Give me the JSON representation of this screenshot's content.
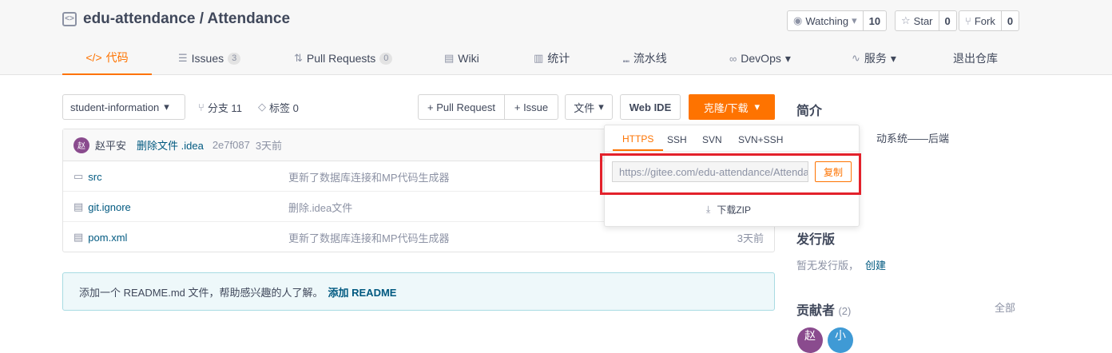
{
  "repo": {
    "title": "edu-attendance / Attendance"
  },
  "social": {
    "watching_label": "Watching",
    "watching_count": "10",
    "star_label": "Star",
    "star_count": "0",
    "fork_label": "Fork",
    "fork_count": "0"
  },
  "tabs": [
    {
      "label": "代码",
      "icon": "code-icon"
    },
    {
      "label": "Issues",
      "badge": "3",
      "icon": "issues-icon"
    },
    {
      "label": "Pull Requests",
      "badge": "0",
      "icon": "pull-request-icon"
    },
    {
      "label": "Wiki",
      "icon": "wiki-icon"
    },
    {
      "label": "统计",
      "icon": "chart-icon"
    },
    {
      "label": "流水线",
      "icon": "pipeline-icon"
    },
    {
      "label": "DevOps",
      "icon": "infinity-icon"
    },
    {
      "label": "服务",
      "icon": "pulse-icon"
    },
    {
      "label": "退出仓库"
    }
  ],
  "toolbar": {
    "branch": "student-information",
    "branches": "分支 11",
    "tags": "标签 0",
    "pull_request": "+ Pull Request",
    "issue": "+ Issue",
    "file": "文件",
    "web_ide": "Web IDE",
    "clone": "克隆/下载"
  },
  "commit": {
    "avatar": "赵",
    "author": "赵平安",
    "message": "删除文件 .idea",
    "hash": "2e7f087",
    "time": "3天前"
  },
  "files": [
    {
      "name": "src",
      "message": "更新了数据库连接和MP代码生成器",
      "time": "",
      "icon": "folder-icon"
    },
    {
      "name": "git.ignore",
      "message": "删除.idea文件",
      "time": "",
      "icon": "file-icon"
    },
    {
      "name": "pom.xml",
      "message": "更新了数据库连接和MP代码生成器",
      "time": "3天前",
      "icon": "file-icon"
    }
  ],
  "readme": {
    "text": "添加一个 README.md 文件，帮助感兴趣的人了解。",
    "link": "添加 README"
  },
  "clone_dropdown": {
    "tabs": [
      "HTTPS",
      "SSH",
      "SVN",
      "SVN+SSH"
    ],
    "url": "https://gitee.com/edu-attendance/Attendance.git",
    "copy": "复制",
    "download_zip": "下载ZIP"
  },
  "sidebar": {
    "intro_title": "简介",
    "intro_text": "动系统——后端",
    "release_title": "发行版",
    "release_text": "暂无发行版，",
    "release_link": "创建",
    "contributors_title": "贡献者",
    "contributors_count": "(2)",
    "contributors_all": "全部",
    "contributors": [
      {
        "initial": "赵",
        "color": "#8a4b8e"
      },
      {
        "initial": "小",
        "color": "#3f9ad5"
      }
    ]
  },
  "colors": {
    "accent": "#fe7300",
    "link": "#005980",
    "highlight": "#e3212b"
  }
}
